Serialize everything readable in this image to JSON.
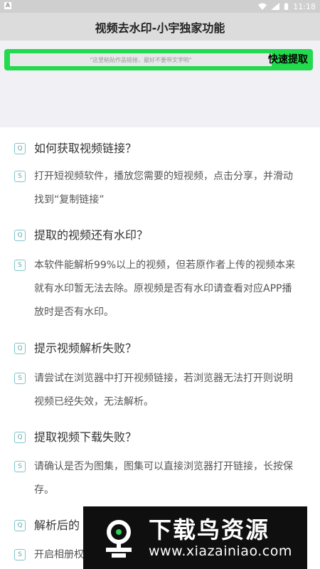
{
  "status_bar": {
    "left_icon": "A",
    "time": "11:18",
    "icons": [
      "wifi-icon",
      "signal-icon",
      "battery-icon"
    ]
  },
  "title": "视频去水印-小宇独家功能",
  "input": {
    "placeholder": "\"这里粘贴作品链接，最好不要带文字哟\"",
    "button_label": "快速提取"
  },
  "faq": [
    {
      "q_badge": "Q",
      "question": "如何获取视频链接？",
      "a_badge": "S",
      "answer": "打开短视频软件，播放您需要的短视频，点击分享，并滑动找到“复制链接”"
    },
    {
      "q_badge": "Q",
      "question": "提取的视频还有水印？",
      "a_badge": "S",
      "answer": "本软件能解析99%以上的视频，但若原作者上传的视频本来就有水印暂无法去除。原视频是否有水印请查看对应APP播放时是否有水印。"
    },
    {
      "q_badge": "Q",
      "question": "提示视频解析失败？",
      "a_badge": "S",
      "answer": "请尝试在浏览器中打开视频链接，若浏览器无法打开则说明视频已经失效，无法解析。"
    },
    {
      "q_badge": "Q",
      "question": "提取视频下载失败？",
      "a_badge": "S",
      "answer": "请确认是否为图集，图集可以直接浏览器打开链接，长按保存。"
    },
    {
      "q_badge": "Q",
      "question": "解析后的",
      "a_badge": "S",
      "answer": "开启相册权"
    }
  ],
  "watermark": {
    "title": "下载鸟资源",
    "url": "www.xiazainiao.com"
  },
  "colors": {
    "accent_green": "#23d94d",
    "badge_teal": "#5aa9ae"
  }
}
